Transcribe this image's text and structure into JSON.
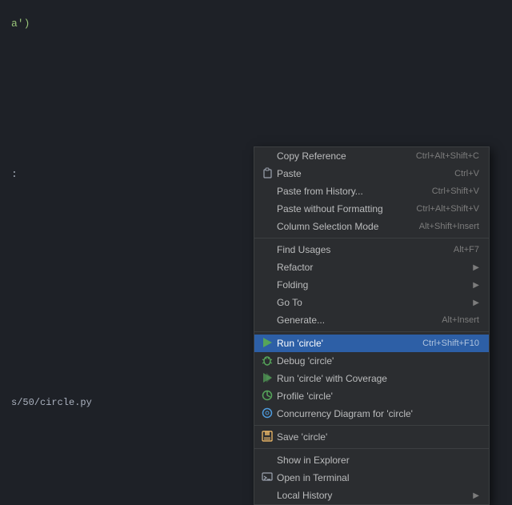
{
  "editor": {
    "bg_color": "#1e2127",
    "code_snippet": "a')",
    "colon_snippet": ":",
    "file_path": "s/50/circle.py"
  },
  "context_menu": {
    "items": [
      {
        "id": "copy-reference",
        "label": "Copy Reference",
        "shortcut": "Ctrl+Alt+Shift+C",
        "has_icon": false,
        "has_arrow": false,
        "is_separator_before": false,
        "active": false
      },
      {
        "id": "paste",
        "label": "Paste",
        "shortcut": "Ctrl+V",
        "has_icon": true,
        "icon_type": "paste",
        "has_arrow": false,
        "is_separator_before": false,
        "active": false
      },
      {
        "id": "paste-from-history",
        "label": "Paste from History...",
        "shortcut": "Ctrl+Shift+V",
        "has_icon": false,
        "has_arrow": false,
        "is_separator_before": false,
        "active": false
      },
      {
        "id": "paste-without-formatting",
        "label": "Paste without Formatting",
        "shortcut": "Ctrl+Alt+Shift+V",
        "has_icon": false,
        "has_arrow": false,
        "is_separator_before": false,
        "active": false
      },
      {
        "id": "column-selection-mode",
        "label": "Column Selection Mode",
        "shortcut": "Alt+Shift+Insert",
        "has_icon": false,
        "has_arrow": false,
        "is_separator_before": false,
        "active": false
      },
      {
        "id": "sep1",
        "type": "separator"
      },
      {
        "id": "find-usages",
        "label": "Find Usages",
        "shortcut": "Alt+F7",
        "has_icon": false,
        "has_arrow": false,
        "active": false
      },
      {
        "id": "refactor",
        "label": "Refactor",
        "shortcut": "",
        "has_icon": false,
        "has_arrow": true,
        "active": false
      },
      {
        "id": "folding",
        "label": "Folding",
        "shortcut": "",
        "has_icon": false,
        "has_arrow": true,
        "active": false
      },
      {
        "id": "go-to",
        "label": "Go To",
        "shortcut": "",
        "has_icon": false,
        "has_arrow": true,
        "active": false
      },
      {
        "id": "generate",
        "label": "Generate...",
        "shortcut": "Alt+Insert",
        "has_icon": false,
        "has_arrow": false,
        "active": false
      },
      {
        "id": "sep2",
        "type": "separator"
      },
      {
        "id": "run-circle",
        "label": "Run 'circle'",
        "shortcut": "Ctrl+Shift+F10",
        "has_icon": true,
        "icon_type": "run",
        "has_arrow": false,
        "active": true
      },
      {
        "id": "debug-circle",
        "label": "Debug 'circle'",
        "shortcut": "",
        "has_icon": true,
        "icon_type": "debug",
        "has_arrow": false,
        "active": false
      },
      {
        "id": "run-circle-coverage",
        "label": "Run 'circle' with Coverage",
        "shortcut": "",
        "has_icon": true,
        "icon_type": "coverage",
        "has_arrow": false,
        "active": false
      },
      {
        "id": "profile-circle",
        "label": "Profile 'circle'",
        "shortcut": "",
        "has_icon": true,
        "icon_type": "profile",
        "has_arrow": false,
        "active": false
      },
      {
        "id": "concurrency-circle",
        "label": "Concurrency Diagram for 'circle'",
        "shortcut": "",
        "has_icon": true,
        "icon_type": "concurrency",
        "has_arrow": false,
        "active": false
      },
      {
        "id": "sep3",
        "type": "separator"
      },
      {
        "id": "save-circle",
        "label": "Save 'circle'",
        "shortcut": "",
        "has_icon": true,
        "icon_type": "save",
        "has_arrow": false,
        "active": false
      },
      {
        "id": "sep4",
        "type": "separator"
      },
      {
        "id": "show-in-explorer",
        "label": "Show in Explorer",
        "shortcut": "",
        "has_icon": false,
        "has_arrow": false,
        "active": false
      },
      {
        "id": "open-in-terminal",
        "label": "Open in Terminal",
        "shortcut": "",
        "has_icon": true,
        "icon_type": "terminal",
        "has_arrow": false,
        "active": false
      },
      {
        "id": "local-history",
        "label": "Local History",
        "shortcut": "",
        "has_icon": false,
        "has_arrow": true,
        "active": false
      }
    ]
  }
}
